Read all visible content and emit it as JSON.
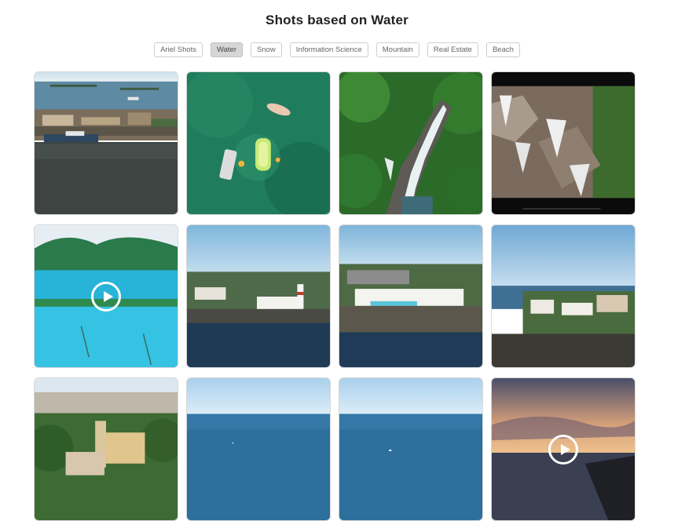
{
  "page": {
    "title": "Shots based on Water"
  },
  "filters": [
    {
      "label": "Ariel Shots",
      "active": false
    },
    {
      "label": "Water",
      "active": true
    },
    {
      "label": "Snow",
      "active": false
    },
    {
      "label": "Information Science",
      "active": false
    },
    {
      "label": "Mountain",
      "active": false
    },
    {
      "label": "Real Estate",
      "active": false
    },
    {
      "label": "Beach",
      "active": false
    }
  ],
  "shots": [
    {
      "scene": "harbor-town-aerial",
      "video": false
    },
    {
      "scene": "swimmers-green-water",
      "video": false
    },
    {
      "scene": "jungle-waterfall",
      "video": false
    },
    {
      "scene": "rocky-waterfall",
      "video": false
    },
    {
      "scene": "blue-lake-mountains",
      "video": true
    },
    {
      "scene": "lighthouse-coast",
      "video": false
    },
    {
      "scene": "hotel-pool-coast",
      "video": false
    },
    {
      "scene": "coastal-cliff-houses",
      "video": false
    },
    {
      "scene": "palace-town-aerial",
      "video": false
    },
    {
      "scene": "open-sea",
      "video": false
    },
    {
      "scene": "open-sea-boat",
      "video": false
    },
    {
      "scene": "sunset-sea",
      "video": true
    }
  ],
  "icons": {
    "play": "play-circle-icon"
  }
}
